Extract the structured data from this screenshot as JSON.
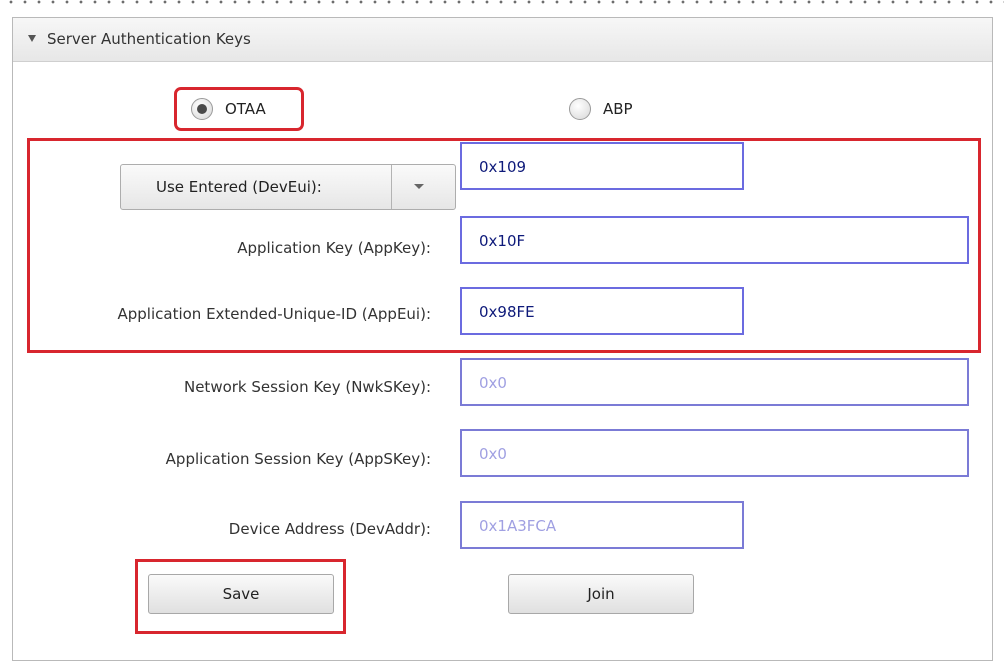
{
  "panel": {
    "title": "Server Authentication Keys"
  },
  "activation": {
    "otaa_label": "OTAA",
    "abp_label": "ABP",
    "selected": "OTAA"
  },
  "deveui": {
    "dropdown_value": "Use Entered (DevEui):",
    "value": "0x109"
  },
  "fields": {
    "app_key": {
      "label": "Application Key (AppKey):",
      "value": "0x10F"
    },
    "app_eui": {
      "label": "Application Extended-Unique-ID (AppEui):",
      "value": "0x98FE"
    },
    "nwk_skey": {
      "label": "Network Session Key (NwkSKey):",
      "value": "0x0"
    },
    "app_skey": {
      "label": "Application Session Key (AppSKey):",
      "value": "0x0"
    },
    "dev_addr": {
      "label": "Device Address (DevAddr):",
      "value": "0x1A3FCA"
    }
  },
  "buttons": {
    "save": "Save",
    "join": "Join"
  },
  "colors": {
    "highlight": "#d8262e",
    "input_border": "#6b6be0",
    "active_text": "#0e1a7a",
    "disabled_text": "#a0a0e2"
  }
}
